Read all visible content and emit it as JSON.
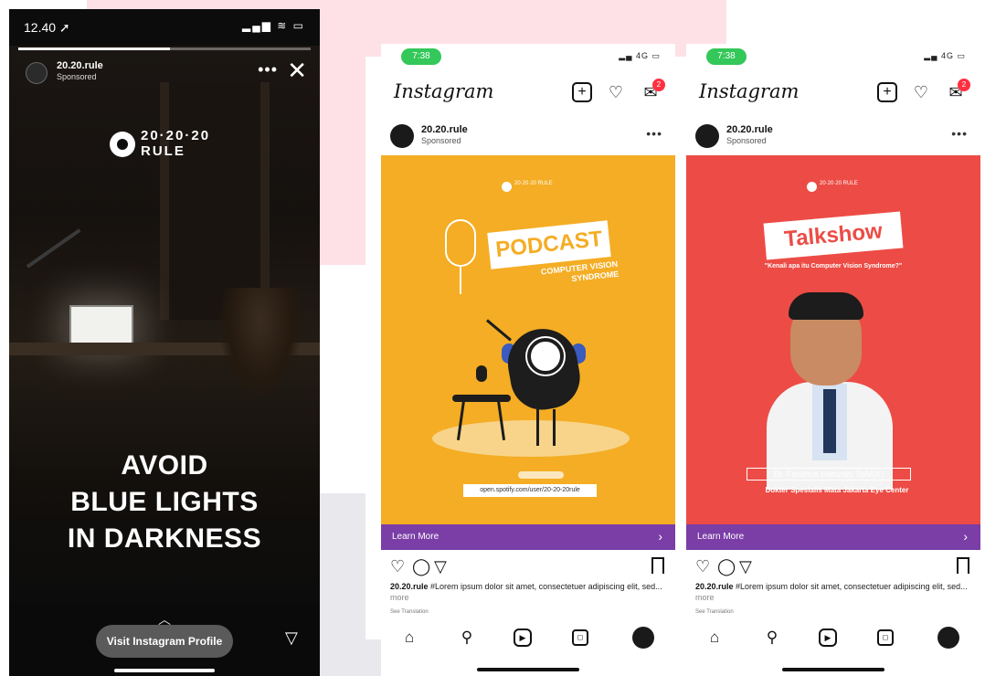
{
  "story": {
    "time": "12.40 ➚",
    "status_icons": "▂▄▆ ≋ ▭",
    "progress": 0.52,
    "account": "20.20.rule",
    "sponsored": "Sponsored",
    "more": "•••",
    "close": "✕",
    "logo_text": "20·20·20 RULE",
    "headline_1": "AVOID",
    "headline_2": "BLUE LIGHTS",
    "headline_3": "IN DARKNESS",
    "chevron": "︿",
    "cta": "Visit Instagram Profile",
    "send": "▽"
  },
  "feeds": [
    {
      "time": "7:38",
      "status_icons": "▂▄ 4G ▭",
      "app_logo": "Instagram",
      "badge": "2",
      "account": "20.20.rule",
      "sponsored": "Sponsored",
      "more": "•••",
      "brand": "20·20·20 RULE",
      "headline": "PODCAST",
      "sub": "COMPUTER VISION SYNDROME",
      "link": "open.spotify.com/user/20-20-20rule",
      "cta": "Learn More",
      "cta_arrow": "›",
      "caption_user": "20.20.rule",
      "caption_text": " #Lorem ipsum dolor sit amet, consectetuer adipiscing elit, sed... ",
      "caption_more": "more",
      "translate": "See Translation"
    },
    {
      "time": "7:38",
      "status_icons": "▂▄ 4G ▭",
      "app_logo": "Instagram",
      "badge": "2",
      "account": "20.20.rule",
      "sponsored": "Sponsored",
      "more": "•••",
      "brand": "20·20·20 RULE",
      "headline": "Talkshow",
      "sub": "\"Kenali apa itu Computer Vision Syndrome?\"",
      "guest_name": "Dr. Feridhus Hamzah, SpM(K)",
      "guest_role": "Dokter Spesialis Mata Jakarta Eye Center",
      "cta": "Learn More",
      "cta_arrow": "›",
      "caption_user": "20.20.rule",
      "caption_text": " #Lorem ipsum dolor sit amet, consectetuer adipiscing elit, sed... ",
      "caption_more": "more",
      "translate": "See Translation"
    }
  ],
  "icons": {
    "add": "+",
    "heart": "♡",
    "messenger": "✉",
    "like": "♡",
    "comment": "◯",
    "share": "▽",
    "home": "⌂",
    "search": "⚲",
    "reels": "▶",
    "shop": "◻"
  },
  "colors": {
    "story_bg": "#0c0c0c",
    "podcast_bg": "#f4ad24",
    "talkshow_bg": "#ec4c45",
    "cta_purple": "#7a3ea6",
    "status_green": "#34c759",
    "badge_red": "#ff3040"
  }
}
